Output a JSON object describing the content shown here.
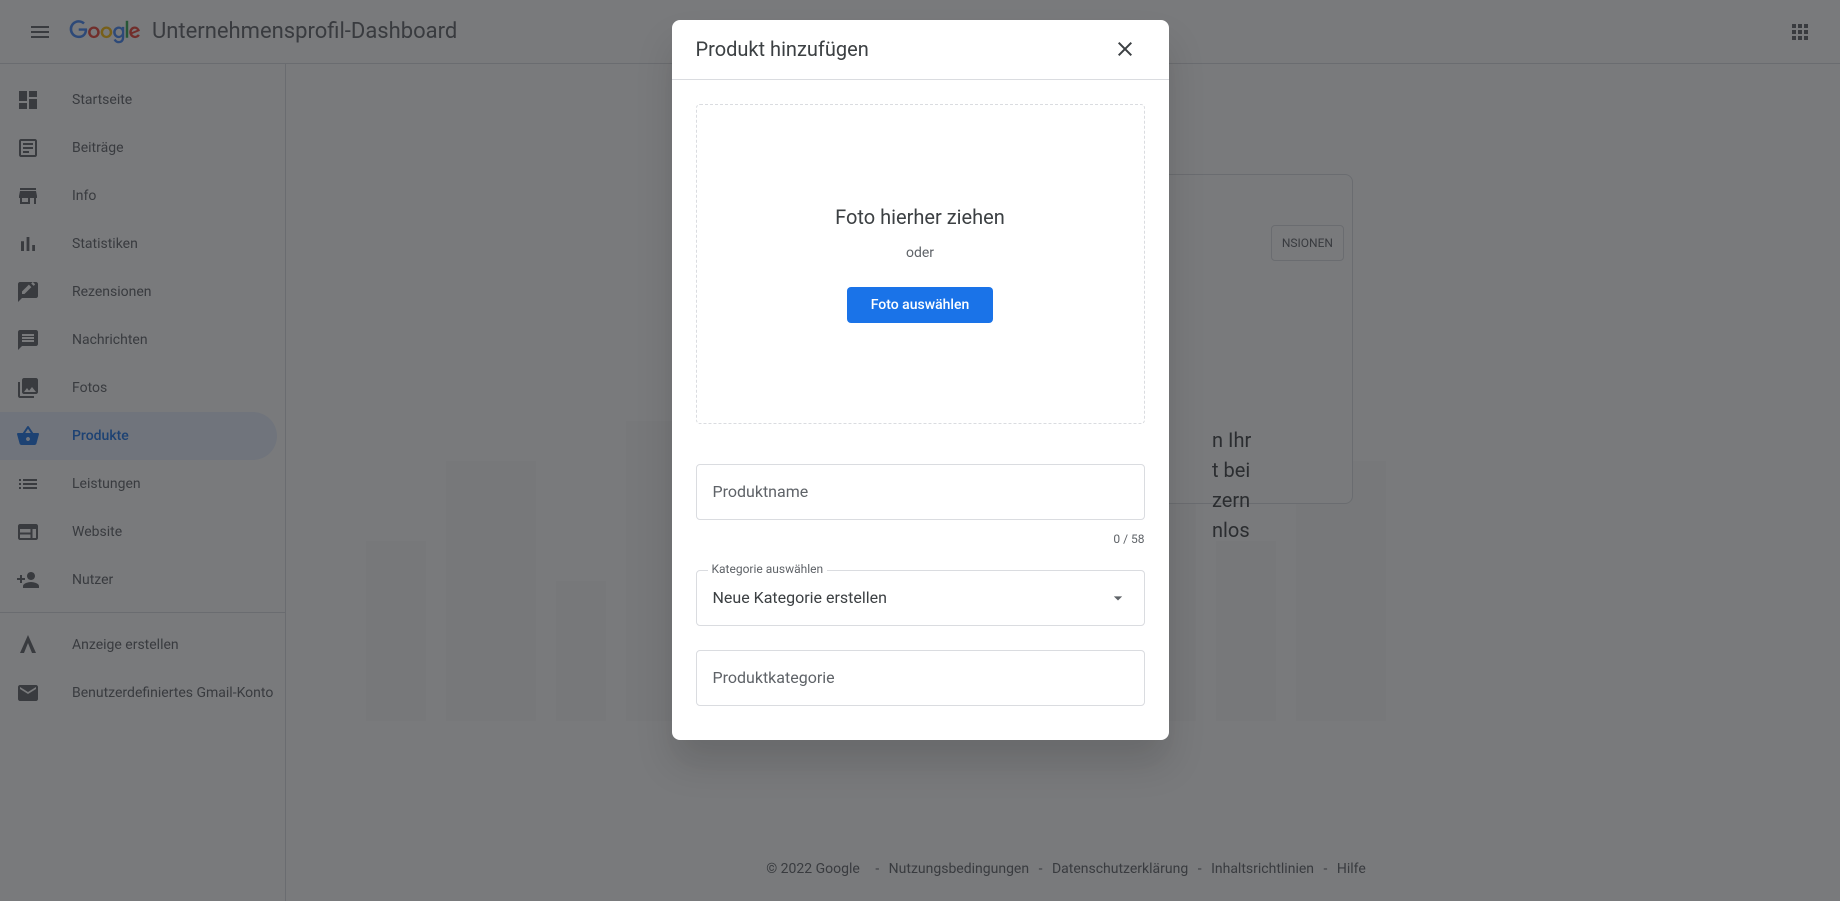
{
  "header": {
    "title": "Unternehmensprofil-Dashboard"
  },
  "sidebar": {
    "items": [
      {
        "label": "Startseite",
        "icon": "dashboard"
      },
      {
        "label": "Beiträge",
        "icon": "post"
      },
      {
        "label": "Info",
        "icon": "store"
      },
      {
        "label": "Statistiken",
        "icon": "bar-chart"
      },
      {
        "label": "Rezensionen",
        "icon": "review"
      },
      {
        "label": "Nachrichten",
        "icon": "message"
      },
      {
        "label": "Fotos",
        "icon": "photo"
      },
      {
        "label": "Produkte",
        "icon": "basket",
        "active": true
      },
      {
        "label": "Leistungen",
        "icon": "list"
      },
      {
        "label": "Website",
        "icon": "web"
      },
      {
        "label": "Nutzer",
        "icon": "person-add"
      }
    ],
    "secondary": [
      {
        "label": "Anzeige erstellen",
        "icon": "ads"
      },
      {
        "label": "Benutzerdefiniertes Gmail-Konto",
        "icon": "gmail"
      }
    ]
  },
  "background": {
    "tab_label": "NSIONEN",
    "card_text_lines": [
      "n Ihr",
      "t bei",
      "zern",
      "nlos"
    ]
  },
  "modal": {
    "title": "Produkt hinzufügen",
    "dropzone": {
      "drag_text": "Foto hierher ziehen",
      "or_text": "oder",
      "button": "Foto auswählen"
    },
    "product_name_placeholder": "Produktname",
    "char_count": "0 / 58",
    "category_select": {
      "label": "Kategorie auswählen",
      "value": "Neue Kategorie erstellen"
    },
    "product_category_placeholder": "Produktkategorie"
  },
  "footer": {
    "copyright": "© 2022 Google",
    "links": [
      "Nutzungsbedingungen",
      "Datenschutzerklärung",
      "Inhaltsrichtlinien",
      "Hilfe"
    ]
  }
}
